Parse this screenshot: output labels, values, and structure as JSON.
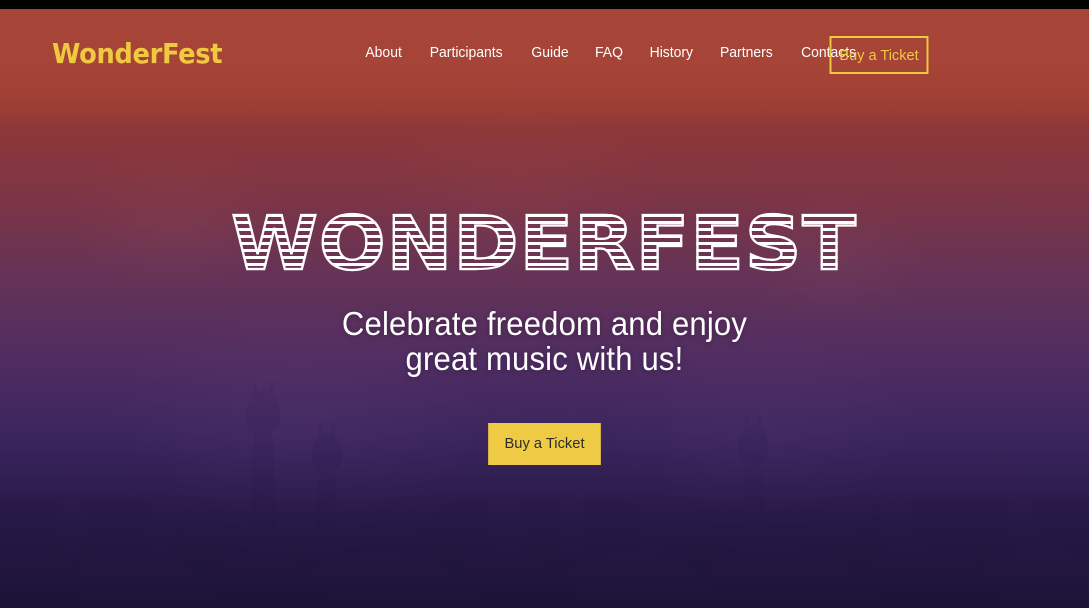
{
  "site": {
    "logo_text": "WonderFest",
    "brand_gold": "#EFC93F",
    "brand_red": "#A64437",
    "brand_purple": "#3A2560",
    "top_bar_color": "#000000"
  },
  "header": {
    "nav_items": [
      {
        "label": "About"
      },
      {
        "label": "Participants"
      },
      {
        "label": "Guide"
      },
      {
        "label": "FAQ"
      },
      {
        "label": "History"
      },
      {
        "label": "Partners"
      },
      {
        "label": "Contacts"
      }
    ],
    "cta_label": "Buy a Ticket"
  },
  "hero": {
    "title": "WonderFest",
    "subtitle_line1": "Celebrate freedom and enjoy",
    "subtitle_line2": "great music with us!",
    "cta_label": "Buy a Ticket"
  }
}
